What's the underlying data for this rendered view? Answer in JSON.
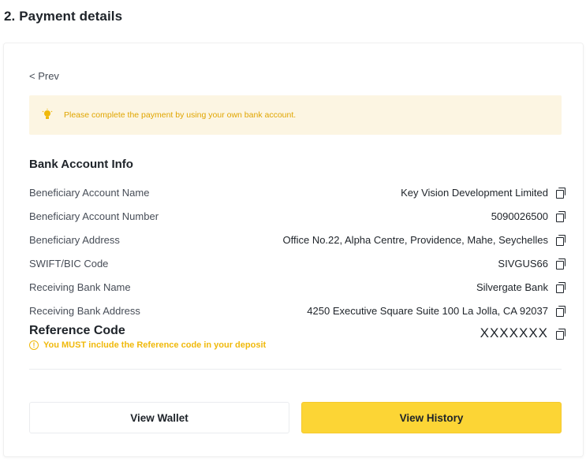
{
  "page": {
    "title": "2. Payment details"
  },
  "nav": {
    "prev_label": "< Prev"
  },
  "notice": {
    "icon": "lightbulb-icon",
    "text": "Please complete the payment by using your own bank account.",
    "color": "#e0a500",
    "background": "#fcf5e2"
  },
  "bank_info": {
    "title": "Bank Account Info",
    "rows": [
      {
        "label": "Beneficiary Account Name",
        "value": "Key Vision Development Limited"
      },
      {
        "label": "Beneficiary Account Number",
        "value": "5090026500"
      },
      {
        "label": "Beneficiary Address",
        "value": "Office No.22, Alpha Centre, Providence, Mahe, Seychelles"
      },
      {
        "label": "SWIFT/BIC Code",
        "value": "SIVGUS66"
      },
      {
        "label": "Receiving Bank Name",
        "value": "Silvergate Bank"
      },
      {
        "label": "Receiving Bank Address",
        "value": "4250 Executive Square Suite 100 La Jolla, CA 92037"
      }
    ]
  },
  "reference": {
    "label": "Reference Code",
    "value": "XXXXXXX",
    "warning": "You MUST include the Reference code in your deposit",
    "warning_color": "#f0b90b"
  },
  "actions": {
    "wallet_label": "View Wallet",
    "history_label": "View History",
    "accent": "#fcd535"
  }
}
